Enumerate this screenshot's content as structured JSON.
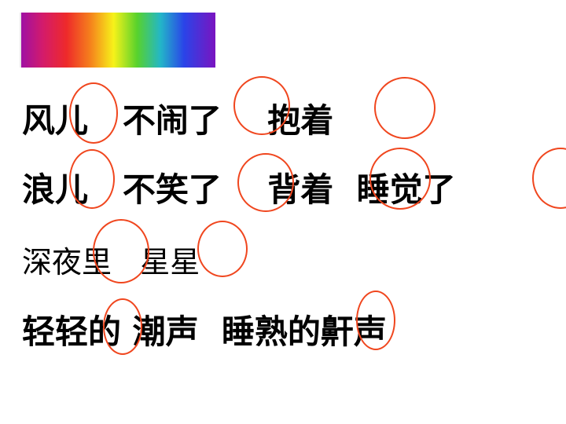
{
  "lines": [
    "风儿   不闹了    抱着",
    "浪儿   不笑了    背着  睡觉了",
    "深夜里   星星",
    "轻轻的 潮声  睡熟的鼾声"
  ],
  "colors": {
    "circle": "#f0461e",
    "text": "#000000"
  }
}
